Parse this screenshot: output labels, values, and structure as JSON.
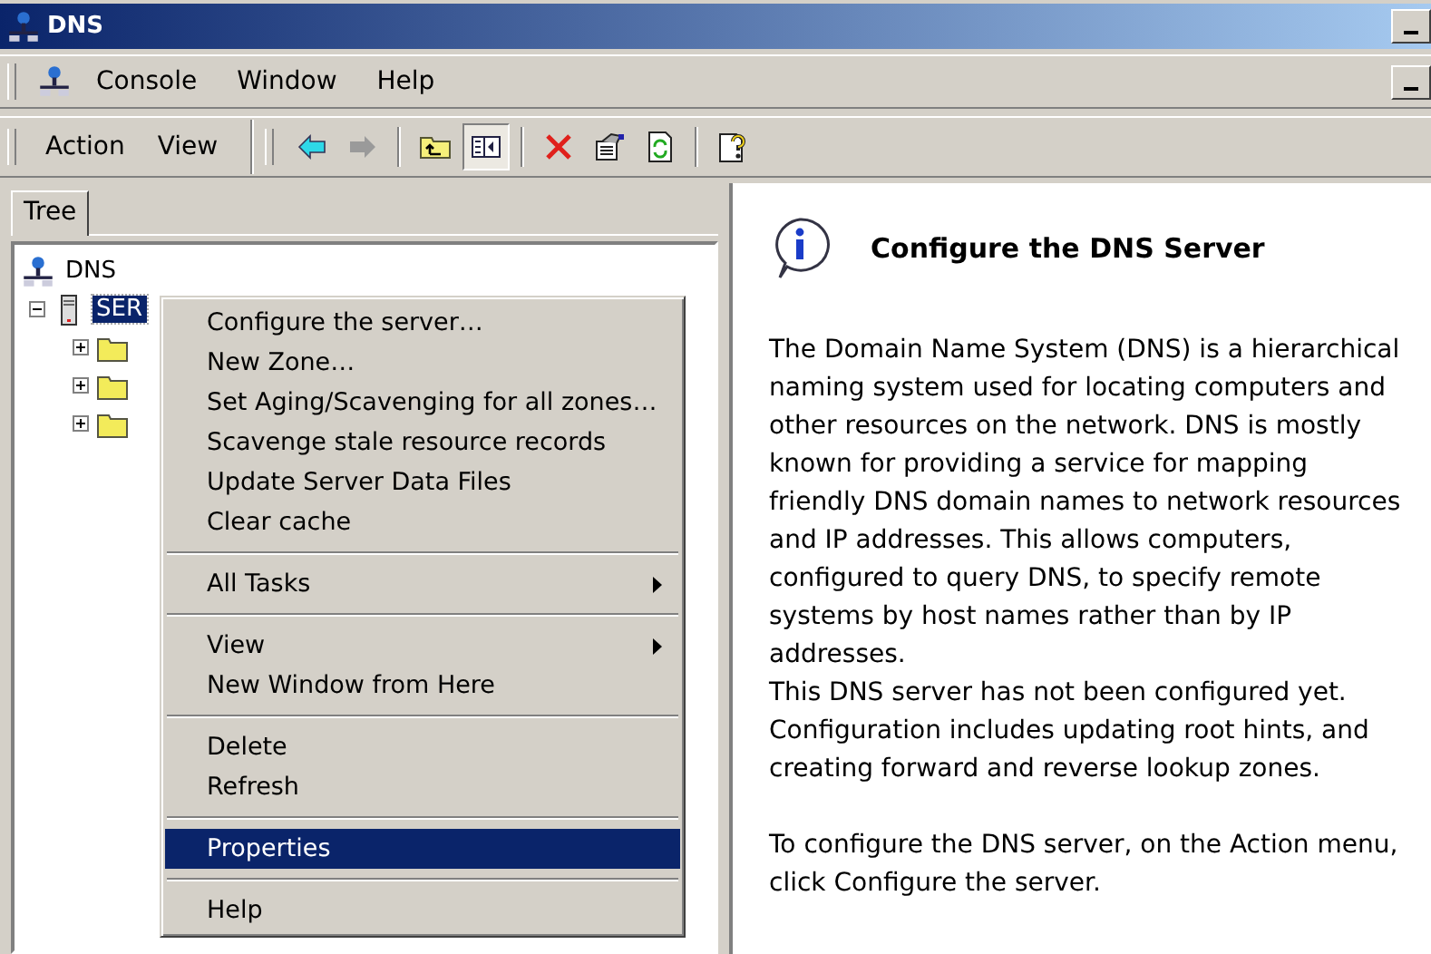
{
  "window": {
    "title": "DNS"
  },
  "menu_bar": [
    {
      "label": "Console"
    },
    {
      "label": "Window"
    },
    {
      "label": "Help"
    }
  ],
  "action_bar": [
    {
      "label": "Action"
    },
    {
      "label": "View"
    }
  ],
  "toolbar": [
    {
      "kind": "back",
      "disabled": false,
      "pressed": false
    },
    {
      "kind": "forward",
      "disabled": true,
      "pressed": false
    },
    {
      "kind": "sep"
    },
    {
      "kind": "up",
      "pressed": false
    },
    {
      "kind": "tree",
      "pressed": true
    },
    {
      "kind": "sep"
    },
    {
      "kind": "delete",
      "pressed": false
    },
    {
      "kind": "properties",
      "pressed": false
    },
    {
      "kind": "refresh",
      "pressed": false
    },
    {
      "kind": "sep"
    },
    {
      "kind": "help",
      "pressed": false
    }
  ],
  "tabs": [
    {
      "label": "Tree",
      "selected": true
    }
  ],
  "tree": [
    {
      "label": "DNS",
      "children": [
        {
          "label": "SER",
          "selected": true,
          "expanded": true,
          "children": [
            {
              "kind": "folder",
              "expanded": false
            },
            {
              "kind": "folder",
              "expanded": false
            },
            {
              "kind": "folder",
              "expanded": false
            }
          ]
        }
      ]
    }
  ],
  "context_menu": [
    {
      "kind": "item",
      "label": "Configure the server…",
      "submenu": false,
      "selected": false
    },
    {
      "kind": "item",
      "label": "New Zone…",
      "submenu": false,
      "selected": false
    },
    {
      "kind": "item",
      "label": "Set Aging/Scavenging for all zones…",
      "submenu": false,
      "selected": false
    },
    {
      "kind": "item",
      "label": "Scavenge stale resource records",
      "submenu": false,
      "selected": false
    },
    {
      "kind": "item",
      "label": "Update Server Data Files",
      "submenu": false,
      "selected": false
    },
    {
      "kind": "item",
      "label": "Clear cache",
      "submenu": false,
      "selected": false
    },
    {
      "kind": "separator"
    },
    {
      "kind": "item",
      "label": "All Tasks",
      "submenu": true,
      "selected": false
    },
    {
      "kind": "separator"
    },
    {
      "kind": "item",
      "label": "View",
      "submenu": true,
      "selected": false
    },
    {
      "kind": "item",
      "label": "New Window from Here",
      "submenu": false,
      "selected": false
    },
    {
      "kind": "separator"
    },
    {
      "kind": "item",
      "label": "Delete",
      "submenu": false,
      "selected": false
    },
    {
      "kind": "item",
      "label": "Refresh",
      "submenu": false,
      "selected": false
    },
    {
      "kind": "separator"
    },
    {
      "kind": "item",
      "label": "Properties",
      "submenu": false,
      "selected": true
    },
    {
      "kind": "separator"
    },
    {
      "kind": "item",
      "label": "Help",
      "submenu": false,
      "selected": false
    }
  ],
  "details": {
    "heading": "Configure the DNS Server",
    "paragraphs": [
      "The Domain Name System (DNS) is a hierarchical naming system used for locating computers and other resources on the network. DNS is mostly known for providing a service for mapping friendly DNS domain names to network resources and IP addresses. This allows computers, configured to query DNS, to specify remote systems by host names rather than by IP addresses.",
      "This DNS server has not been configured yet. Configuration includes updating root hints, and creating forward and reverse lookup zones.",
      "To configure the DNS server, on the Action menu, click Configure the server."
    ]
  }
}
